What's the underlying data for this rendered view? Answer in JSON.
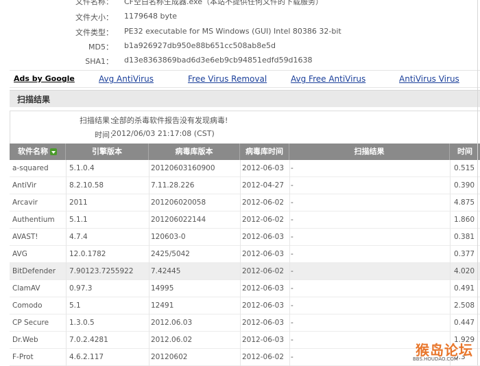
{
  "file_info": {
    "rows": [
      {
        "label": "文件名称",
        "value": "CF空白名称生成器.exe（本站不提供任何文件的下载服务）"
      },
      {
        "label": "文件大小",
        "value": "1179648 byte"
      },
      {
        "label": "文件类型",
        "value": "PE32 executable for MS Windows (GUI) Intel 80386 32-bit"
      },
      {
        "label": "MD5",
        "value": "b1a926927db950e88b651cc508ab8e5d"
      },
      {
        "label": "SHA1",
        "value": "d13e8363869bad6d3e6eb9cb94851edfd59d1638"
      }
    ]
  },
  "ads": {
    "title": "Ads by Google",
    "links": [
      "Avg AntiVirus",
      "Free Virus Removal",
      "Avg Free AntiVirus",
      "AntiVirus Virus"
    ]
  },
  "section_title": "扫描结果",
  "scan_summary": {
    "result_label": "扫描结果：",
    "result_value": "全部的杀毒软件报告没有发现病毒!",
    "time_label": "时间：",
    "time_value": "2012/06/03 21:17:08 (CST)"
  },
  "table": {
    "headers": [
      "软件名称",
      "引擎版本",
      "病毒库版本",
      "病毒库时间",
      "扫描结果",
      "时间"
    ],
    "sort_icon": "sort-down-icon",
    "rows": [
      {
        "name": "a-squared",
        "engine": "5.1.0.4",
        "db": "20120603160900",
        "date": "2012-06-03",
        "result": "-",
        "time": "0.515"
      },
      {
        "name": "AntiVir",
        "engine": "8.2.10.58",
        "db": "7.11.28.226",
        "date": "2012-04-27",
        "result": "-",
        "time": "0.390"
      },
      {
        "name": "Arcavir",
        "engine": "2011",
        "db": "201206020058",
        "date": "2012-06-02",
        "result": "-",
        "time": "4.875"
      },
      {
        "name": "Authentium",
        "engine": "5.1.1",
        "db": "201206022144",
        "date": "2012-06-02",
        "result": "-",
        "time": "1.860"
      },
      {
        "name": "AVAST!",
        "engine": "4.7.4",
        "db": "120603-0",
        "date": "2012-06-03",
        "result": "-",
        "time": "0.381"
      },
      {
        "name": "AVG",
        "engine": "12.0.1782",
        "db": "2425/5042",
        "date": "2012-06-03",
        "result": "-",
        "time": "0.377"
      },
      {
        "name": "BitDefender",
        "engine": "7.90123.7255922",
        "db": "7.42445",
        "date": "2012-06-02",
        "result": "-",
        "time": "4.020"
      },
      {
        "name": "ClamAV",
        "engine": "0.97.3",
        "db": "14995",
        "date": "2012-06-03",
        "result": "-",
        "time": "0.491"
      },
      {
        "name": "Comodo",
        "engine": "5.1",
        "db": "12491",
        "date": "2012-06-03",
        "result": "-",
        "time": "2.508"
      },
      {
        "name": "CP Secure",
        "engine": "1.3.0.5",
        "db": "2012.06.03",
        "date": "2012-06-03",
        "result": "-",
        "time": "0.447"
      },
      {
        "name": "Dr.Web",
        "engine": "7.0.2.4281",
        "db": "2012.06.02",
        "date": "2012-06-03",
        "result": "-",
        "time": "1.929"
      },
      {
        "name": "F-Prot",
        "engine": "4.6.2.117",
        "db": "20120602",
        "date": "2012-06-02",
        "result": "-",
        "time": "0.3"
      }
    ]
  },
  "watermark": {
    "text": "猴岛论坛",
    "url": "BBS.HOUDAO.COM"
  },
  "colors": {
    "link": "#1a3f9a",
    "table_header_bg": "#8a8a8a",
    "section_bg": "#e9e9e9",
    "watermark": "#e8762b"
  }
}
